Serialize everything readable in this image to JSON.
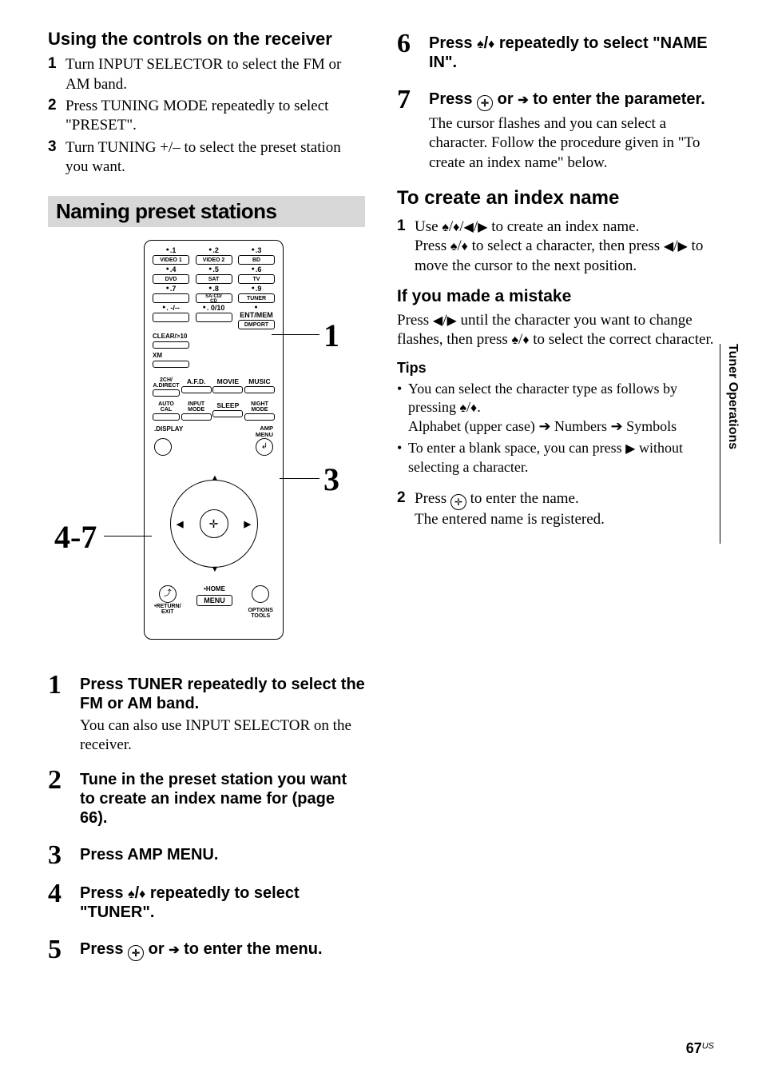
{
  "left": {
    "heading_controls": "Using the controls on the receiver",
    "steps_plain": [
      "Turn INPUT SELECTOR to select the FM or AM band.",
      "Press TUNING MODE repeatedly to select \"PRESET\".",
      "Turn TUNING +/– to select the preset station you want."
    ],
    "band_heading": "Naming preset stations",
    "callouts": {
      "c1": "1",
      "c3": "3",
      "c47": "4-7"
    },
    "remote": {
      "row1": [
        {
          "dot": ".1",
          "cap": "VIDEO 1"
        },
        {
          "dot": ".2",
          "cap": "VIDEO 2"
        },
        {
          "dot": ".3",
          "cap": "BD"
        }
      ],
      "row2": [
        {
          "dot": ".4",
          "cap": "DVD"
        },
        {
          "dot": ".5",
          "cap": "SAT"
        },
        {
          "dot": ".6",
          "cap": "TV"
        }
      ],
      "row3": [
        {
          "dot": ".7",
          "cap": ""
        },
        {
          "dot": ".8",
          "cap": "SA-CD/\nCD"
        },
        {
          "dot": ".9",
          "cap": "TUNER"
        }
      ],
      "row4": [
        {
          "dot": ". -/--",
          "cap": ""
        },
        {
          "dot": ". 0/10",
          "cap": ""
        },
        {
          "dot": ".ENT/MEM",
          "cap": "DMPORT"
        }
      ],
      "clear": "CLEAR/>10",
      "xm": "XM",
      "mode_row_top": [
        "2CH/\nA.DIRECT",
        "A.F.D.",
        "MOVIE",
        "MUSIC"
      ],
      "mode_row_bot": [
        "AUTO CAL",
        "INPUT\nMODE",
        "SLEEP",
        "NIGHT\nMODE"
      ],
      "display": ".DISPLAY",
      "amp_menu": "AMP\nMENU",
      "return": ".RETURN/\nEXIT",
      "home": ".HOME",
      "options": "OPTIONS\nTOOLS",
      "menu": "MENU"
    },
    "big_steps": [
      {
        "n": "1",
        "head": "Press TUNER repeatedly to select the FM or AM band.",
        "body": "You can also use INPUT SELECTOR on the receiver."
      },
      {
        "n": "2",
        "head": "Tune in the preset station you want to create an index name for (page 66).",
        "body": ""
      },
      {
        "n": "3",
        "head": "Press AMP MENU.",
        "body": ""
      },
      {
        "n": "4",
        "head": "Press ↑/↓ repeatedly to select \"TUNER\".",
        "body": ""
      },
      {
        "n": "5",
        "head": "Press ⊕ or → to enter the menu.",
        "body": ""
      }
    ]
  },
  "right": {
    "big_steps": [
      {
        "n": "6",
        "head": "Press ↑/↓ repeatedly to select \"NAME IN\".",
        "body": ""
      },
      {
        "n": "7",
        "head": "Press ⊕ or → to enter the parameter.",
        "body": "The cursor flashes and you can select a character. Follow the procedure given in \"To create an index name\" below."
      }
    ],
    "h2_create": "To create an index name",
    "create_steps": [
      {
        "n": "1",
        "line1": "Use ↑/↓/←/→ to create an index name.",
        "line2": "Press ↑/↓ to select a character, then press ←/→ to move the cursor to the next position."
      }
    ],
    "h4_mistake": "If you made a mistake",
    "mistake_body": "Press ←/→ until the character you want to change flashes, then press ↑/↓ to select the correct character.",
    "h5_tips": "Tips",
    "tips": [
      "You can select the character type as follows by pressing ↑/↓.\nAlphabet (upper case) → Numbers → Symbols",
      "To enter a blank space, you can press → without selecting a character."
    ],
    "create_steps2": [
      {
        "n": "2",
        "line1": "Press ⊕ to enter the name.",
        "line2": "The entered name is registered."
      }
    ]
  },
  "side_tab": "Tuner Operations",
  "page_number": "67",
  "page_region": "US"
}
